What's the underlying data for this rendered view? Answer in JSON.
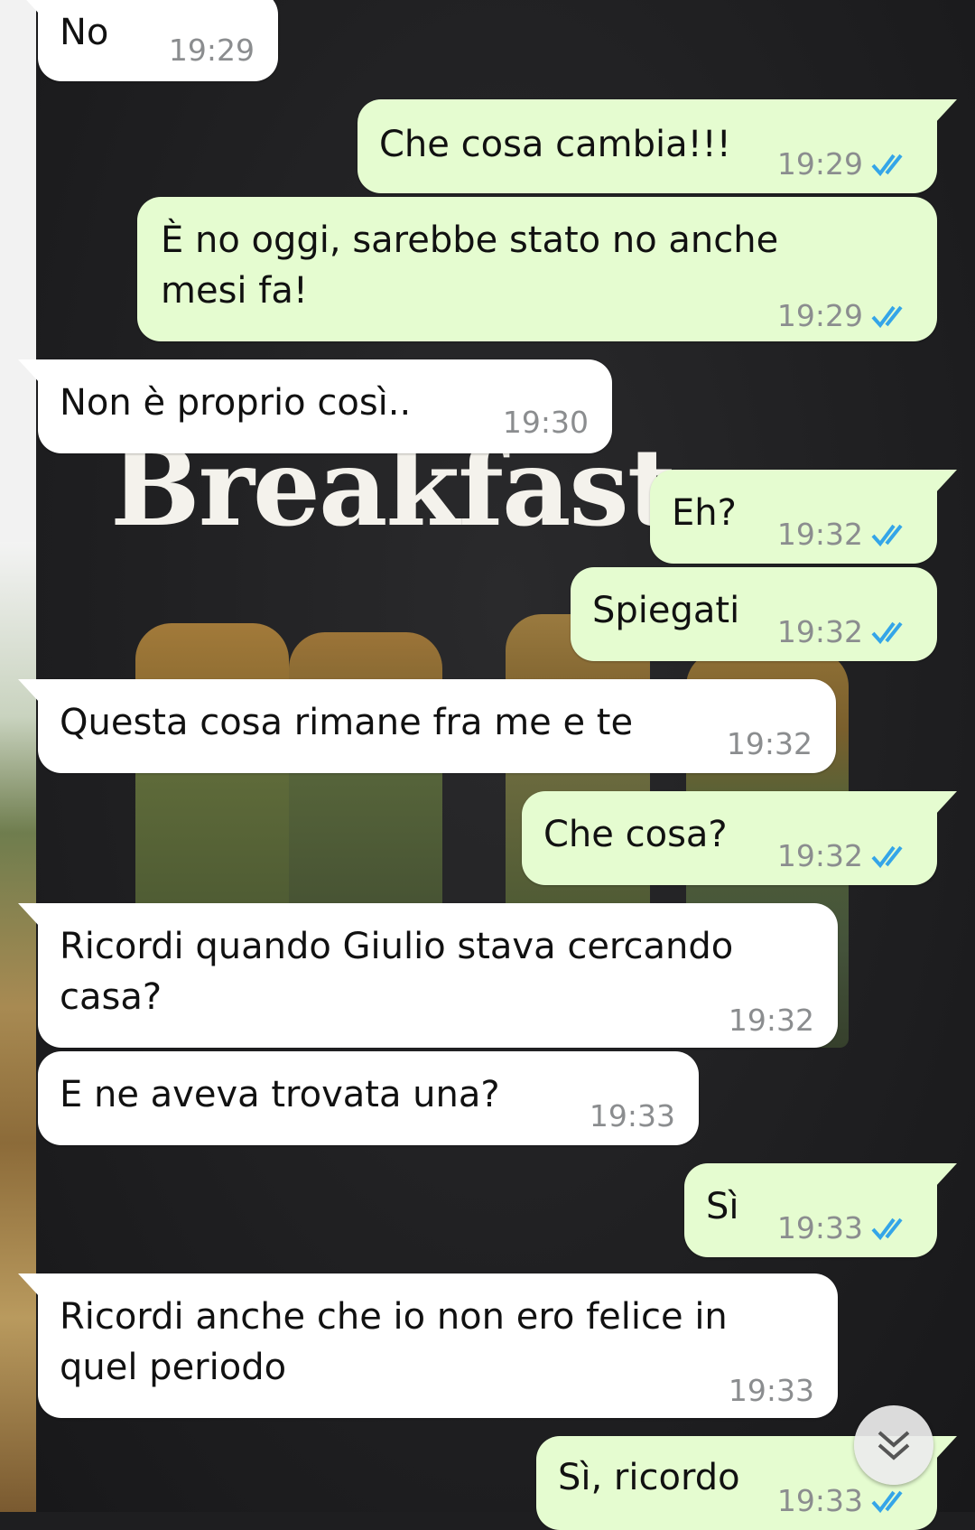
{
  "messages": [
    {
      "dir": "in",
      "text": "No",
      "time": "19:29",
      "read": false
    },
    {
      "dir": "out",
      "text": "Che cosa cambia!!!",
      "time": "19:29",
      "read": true
    },
    {
      "dir": "out",
      "text": "È no oggi, sarebbe stato no anche\nmesi fa!",
      "time": "19:29",
      "read": true
    },
    {
      "dir": "in",
      "text": "Non è proprio così..",
      "time": "19:30",
      "read": false
    },
    {
      "dir": "out",
      "text": "Eh?",
      "time": "19:32",
      "read": true
    },
    {
      "dir": "out",
      "text": "Spiegati",
      "time": "19:32",
      "read": true
    },
    {
      "dir": "in",
      "text": "Questa cosa rimane fra me e te",
      "time": "19:32",
      "read": false
    },
    {
      "dir": "out",
      "text": "Che cosa?",
      "time": "19:32",
      "read": true
    },
    {
      "dir": "in",
      "text": "Ricordi quando Giulio stava cercando\ncasa?",
      "time": "19:32",
      "read": false
    },
    {
      "dir": "in",
      "text": "E ne aveva trovata una?",
      "time": "19:33",
      "read": false
    },
    {
      "dir": "out",
      "text": "Sì",
      "time": "19:33",
      "read": true
    },
    {
      "dir": "in",
      "text": "Ricordi anche che io non ero felice in\nquel periodo",
      "time": "19:33",
      "read": false
    },
    {
      "dir": "out",
      "text": "Sì, ricordo",
      "time": "19:33",
      "read": true
    }
  ],
  "wallpaper": {
    "text": "Breakfast"
  },
  "colors": {
    "incoming": "#ffffff",
    "outgoing": "#e5fcd0",
    "read_tick": "#34a5e8",
    "time": "#8b8d8f"
  },
  "icons": {
    "read_receipt": "double-check-icon",
    "scroll_down": "chevron-double-down-icon"
  }
}
